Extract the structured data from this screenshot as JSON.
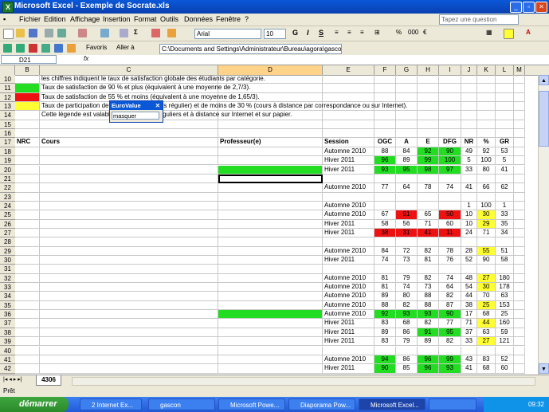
{
  "window": {
    "title": "Microsoft Excel - Exemple de Socrate.xls"
  },
  "menu": [
    "Fichier",
    "Edition",
    "Affichage",
    "Insertion",
    "Format",
    "Outils",
    "Données",
    "Fenêtre",
    "?"
  ],
  "ask_placeholder": "Tapez une question",
  "toolbar": {
    "favoris": "Favoris",
    "aller": "Aller à",
    "path": "C:\\Documents and Settings\\Administrateur\\Bureau\\agora\\gascon\\",
    "font": "Arial",
    "size": "10"
  },
  "namebox": "D21",
  "fx": "fx",
  "columns": [
    "B",
    "C",
    "D",
    "E",
    "F",
    "G",
    "H",
    "I",
    "J",
    "K",
    "L",
    "M"
  ],
  "legend": {
    "r10": "les chiffres indiquent le taux de satisfaction globale des étudiants par catégorie.",
    "r11": "Taux de satisfaction de 90 % et plus (équivalent à une moyenne de 2,7/3).",
    "r12": "Taux de satisfaction de 55 % et moins (équivalent à une moyenne de 1,65/3).",
    "r13": "Taux de participation de plus de 50 % (cours régulier) et de moins de 30 % (cours à distance par correspondance ou sur Internet).",
    "r14": "Cette légende est valable pour les cours réguliers et à distance sur Internet et sur papier."
  },
  "headers": {
    "nrc": "NRC",
    "cours": "Cours",
    "prof": "Professeur(e)",
    "session": "Session",
    "ogc": "OGC",
    "a": "A",
    "e": "E",
    "dfg": "DFG",
    "nr": "NR",
    "pct": "%",
    "gr": "GR"
  },
  "rows": [
    {
      "n": "10"
    },
    {
      "n": "11"
    },
    {
      "n": "12"
    },
    {
      "n": "13"
    },
    {
      "n": "14"
    },
    {
      "n": "15"
    },
    {
      "n": "16"
    },
    {
      "n": "17"
    },
    {
      "n": "18",
      "session": "Automne 2010",
      "v": [
        "88",
        "84",
        "92",
        "90",
        "49",
        "92",
        "53"
      ],
      "c": [
        "",
        "",
        "g",
        "g",
        "",
        "",
        ""
      ]
    },
    {
      "n": "19",
      "session": "Hiver 2011",
      "v": [
        "96",
        "89",
        "99",
        "100",
        "5",
        "100",
        "5"
      ],
      "c": [
        "g",
        "",
        "g",
        "g",
        "",
        "",
        ""
      ]
    },
    {
      "n": "20",
      "session": "Hiver 2011",
      "v": [
        "93",
        "95",
        "98",
        "97",
        "33",
        "80",
        "41"
      ],
      "c": [
        "g",
        "g",
        "g",
        "g",
        "",
        "",
        ""
      ],
      "prof": "g"
    },
    {
      "n": "21"
    },
    {
      "n": "22",
      "session": "Automne 2010",
      "v": [
        "77",
        "64",
        "78",
        "74",
        "41",
        "66",
        "62"
      ],
      "c": [
        "",
        "",
        "",
        "",
        "",
        "",
        ""
      ]
    },
    {
      "n": "23"
    },
    {
      "n": "24",
      "session": "Automne 2010",
      "v": [
        "",
        "",
        "",
        "",
        "1",
        "100",
        "1"
      ],
      "c": [
        "",
        "",
        "",
        "",
        "",
        "",
        ""
      ]
    },
    {
      "n": "25",
      "session": "Automne 2010",
      "v": [
        "67",
        "51",
        "65",
        "50",
        "10",
        "30",
        "33"
      ],
      "c": [
        "",
        "r",
        "",
        "r",
        "",
        "y",
        ""
      ]
    },
    {
      "n": "26",
      "session": "Hiver 2011",
      "v": [
        "58",
        "56",
        "71",
        "60",
        "10",
        "29",
        "35"
      ],
      "c": [
        "",
        "",
        "",
        "",
        "",
        "y",
        ""
      ]
    },
    {
      "n": "27",
      "session": "Hiver 2011",
      "v": [
        "38",
        "31",
        "41",
        "11",
        "24",
        "71",
        "34"
      ],
      "c": [
        "r",
        "r",
        "r",
        "r",
        "",
        "",
        ""
      ]
    },
    {
      "n": "28"
    },
    {
      "n": "29",
      "session": "Automne 2010",
      "v": [
        "84",
        "72",
        "82",
        "78",
        "28",
        "55",
        "51"
      ],
      "c": [
        "",
        "",
        "",
        "",
        "",
        "y",
        ""
      ]
    },
    {
      "n": "30",
      "session": "Hiver 2011",
      "v": [
        "74",
        "73",
        "81",
        "76",
        "52",
        "90",
        "58"
      ],
      "c": [
        "",
        "",
        "",
        "",
        "",
        "",
        ""
      ]
    },
    {
      "n": "31"
    },
    {
      "n": "32",
      "session": "Automne 2010",
      "v": [
        "81",
        "79",
        "82",
        "74",
        "48",
        "27",
        "180"
      ],
      "c": [
        "",
        "",
        "",
        "",
        "",
        "y",
        ""
      ]
    },
    {
      "n": "33",
      "session": "Automne 2010",
      "v": [
        "81",
        "74",
        "73",
        "64",
        "54",
        "30",
        "178"
      ],
      "c": [
        "",
        "",
        "",
        "",
        "",
        "y",
        ""
      ]
    },
    {
      "n": "34",
      "session": "Automne 2010",
      "v": [
        "89",
        "80",
        "88",
        "82",
        "44",
        "70",
        "63"
      ],
      "c": [
        "",
        "",
        "",
        "",
        "",
        "",
        ""
      ]
    },
    {
      "n": "35",
      "session": "Automne 2010",
      "v": [
        "88",
        "82",
        "88",
        "87",
        "38",
        "25",
        "153"
      ],
      "c": [
        "",
        "",
        "",
        "",
        "",
        "y",
        ""
      ]
    },
    {
      "n": "36",
      "session": "Automne 2010",
      "v": [
        "92",
        "93",
        "93",
        "90",
        "17",
        "68",
        "25"
      ],
      "c": [
        "g",
        "g",
        "g",
        "g",
        "",
        "",
        ""
      ],
      "prof": "g"
    },
    {
      "n": "37",
      "session": "Hiver 2011",
      "v": [
        "83",
        "68",
        "82",
        "77",
        "71",
        "44",
        "160"
      ],
      "c": [
        "",
        "",
        "",
        "",
        "",
        "y",
        ""
      ]
    },
    {
      "n": "38",
      "session": "Hiver 2011",
      "v": [
        "89",
        "86",
        "91",
        "95",
        "37",
        "63",
        "59"
      ],
      "c": [
        "",
        "",
        "g",
        "g",
        "",
        "",
        ""
      ]
    },
    {
      "n": "39",
      "session": "Hiver 2011",
      "v": [
        "83",
        "79",
        "89",
        "82",
        "33",
        "27",
        "121"
      ],
      "c": [
        "",
        "",
        "",
        "",
        "",
        "y",
        ""
      ]
    },
    {
      "n": "40"
    },
    {
      "n": "41",
      "session": "Automne 2010",
      "v": [
        "94",
        "86",
        "96",
        "99",
        "43",
        "83",
        "52"
      ],
      "c": [
        "g",
        "",
        "g",
        "g",
        "",
        "",
        ""
      ]
    },
    {
      "n": "42",
      "session": "Hiver 2011",
      "v": [
        "90",
        "85",
        "96",
        "93",
        "41",
        "68",
        "60"
      ],
      "c": [
        "g",
        "",
        "g",
        "g",
        "",
        "",
        ""
      ]
    }
  ],
  "sheet_tab": "4306",
  "status": "Prêt",
  "eurovalue": {
    "title": "EuroValue",
    "option": "masquer"
  },
  "taskbar": {
    "start": "démarrer",
    "items": [
      "2 Internet Ex...",
      "gascon",
      "Microsoft Powe...",
      "Diaporama Pow...",
      "Microsoft Excel...",
      ""
    ],
    "clock": "09:32"
  },
  "colors": {
    "green": "#22dd22",
    "yellow": "#ffff33",
    "red": "#ee1111",
    "title": "#0a58d8"
  }
}
